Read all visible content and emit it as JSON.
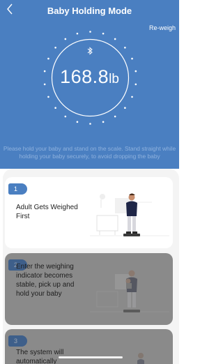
{
  "header": {
    "title": "Baby Holding Mode",
    "back_icon": "chevron-left-icon",
    "reweigh_label": "Re-weigh",
    "bluetooth_icon": "bluetooth-icon",
    "weight_value": "168.8",
    "weight_unit": "lb",
    "instruction": "Please hold your baby and stand on the scale. Stand straight while holding your baby securely, to avoid dropping the baby"
  },
  "steps": [
    {
      "number": "1",
      "text": "Adult Gets Weighed First"
    },
    {
      "number": "2",
      "text": "Enter the weighing indicator becomes stable, pick up and hold your baby"
    },
    {
      "number": "3",
      "text": "The system will automatically"
    }
  ],
  "colors": {
    "header_bg": "#4a7fc1",
    "accent": "#4a7fc1",
    "sheet_bg": "#f4f4f4",
    "disabled_card": "#8a8a8a"
  }
}
